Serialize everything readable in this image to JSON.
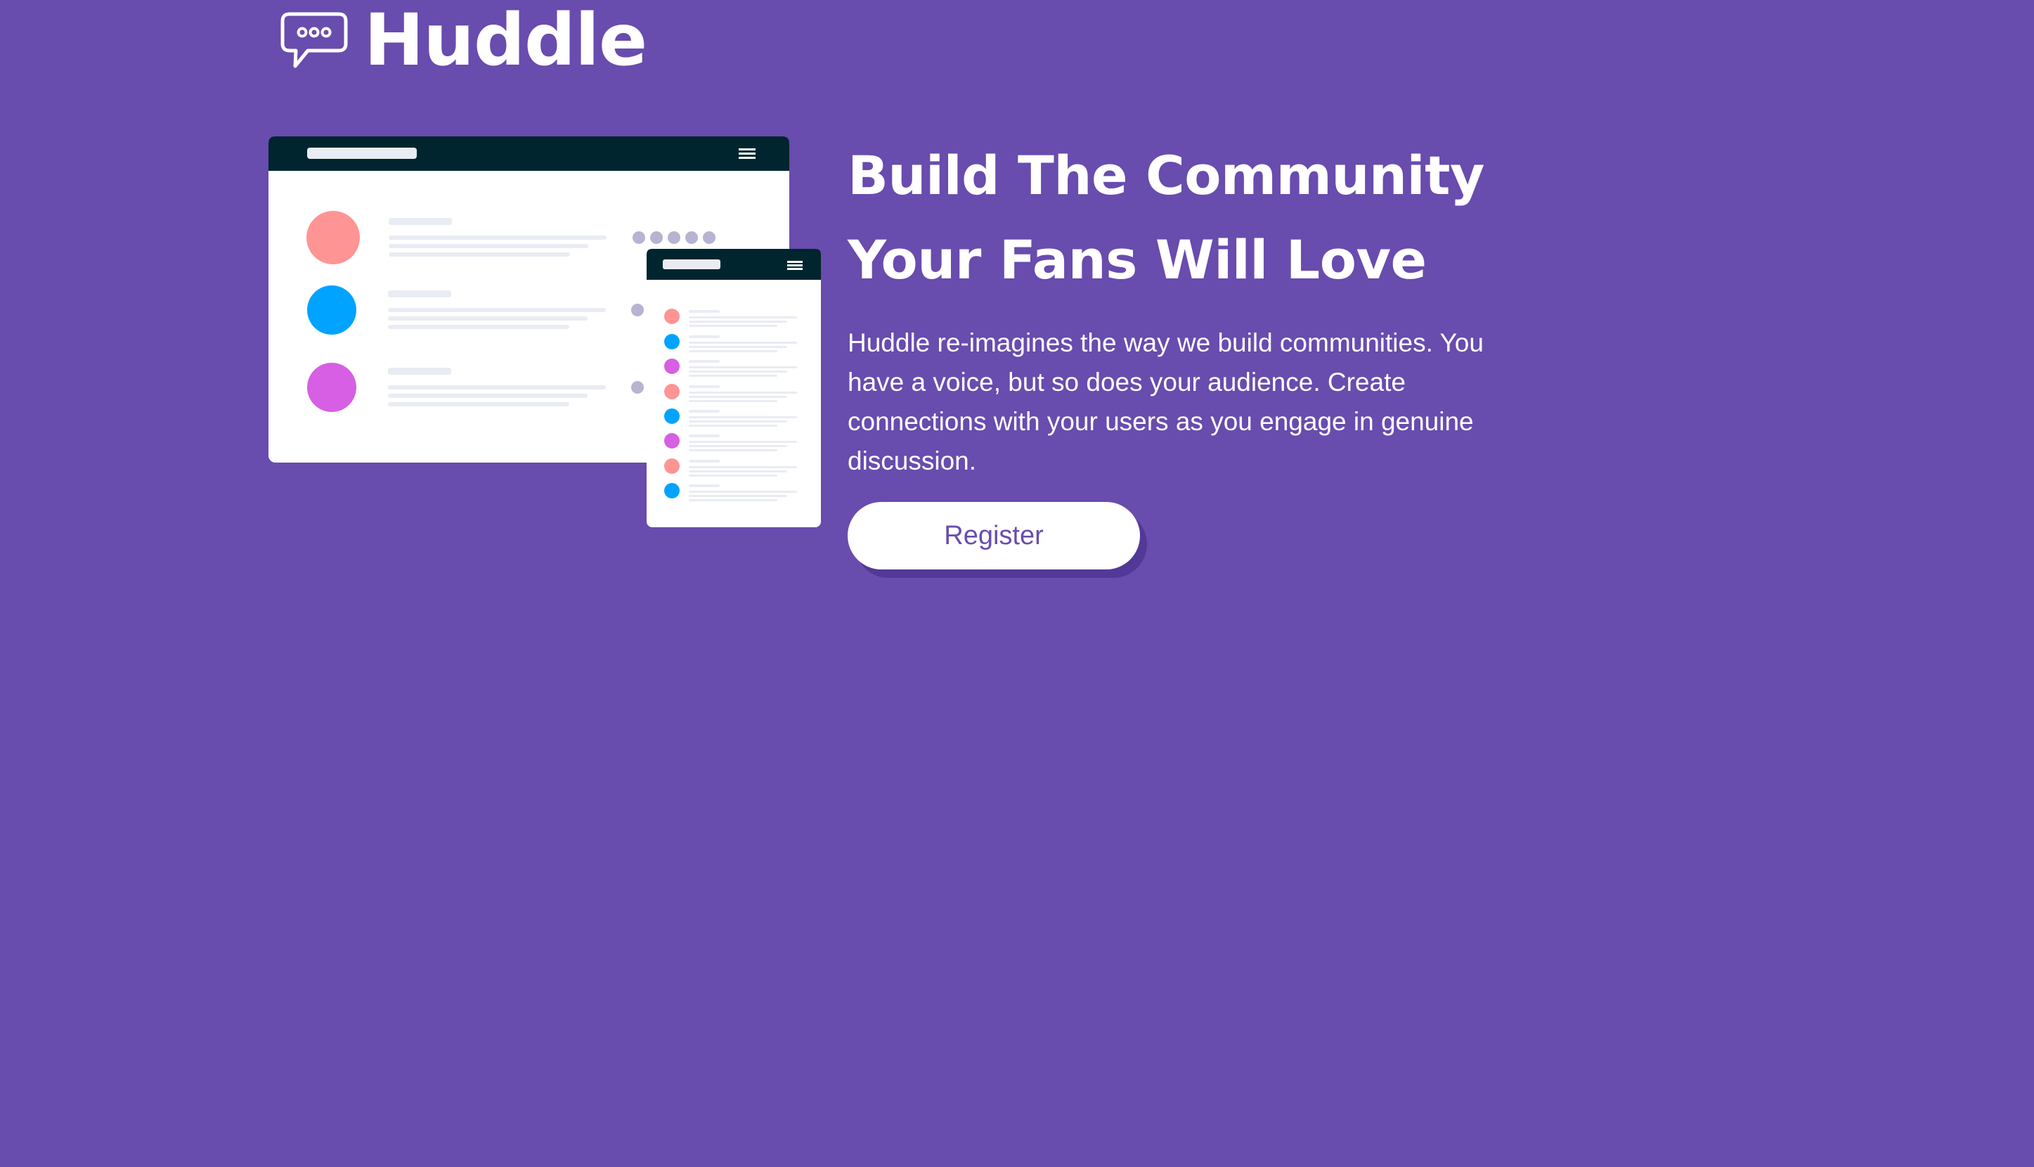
{
  "brand": {
    "name": "Huddle",
    "logo_icon": "chat-bubble-icon"
  },
  "hero": {
    "title_line1": "Build The Community",
    "title_line2": "Your Fans Will Love",
    "description": "Huddle re-imagines the way we build communities. You have a voice, but so does your audience. Create connections with your users as you engage in genuine discussion.",
    "register_label": "Register",
    "illustration_icon": "community-app-mockup-icon"
  },
  "colors": {
    "background": "#684cae",
    "mockup_header": "#00252e",
    "avatar_pink": "#ff9494",
    "avatar_blue": "#00a3ff",
    "avatar_magenta": "#d65fe3",
    "white": "#ffffff"
  }
}
